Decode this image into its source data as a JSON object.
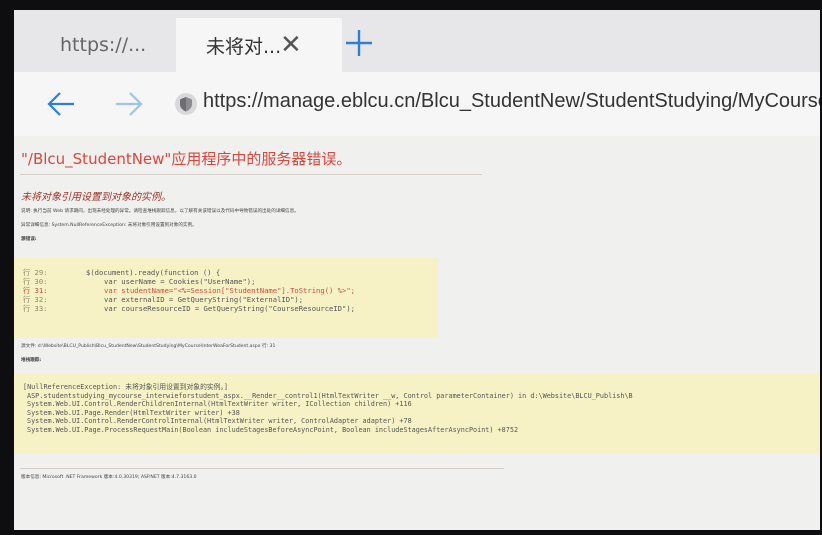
{
  "tabs": [
    {
      "title": "https://..."
    },
    {
      "title": "未将对..."
    }
  ],
  "address_bar": {
    "url": "https://manage.eblcu.cn/Blcu_StudentNew/StudentStudying/MyCourse/InterW"
  },
  "error_page": {
    "title": "\"/Blcu_StudentNew\"应用程序中的服务器错误。",
    "heading": "未将对象引用设置到对象的实例。",
    "description": "说明: 执行当前 Web 请求期间，出现未经处理的异常。请检查堆栈跟踪信息，以了解有关该错误以及代码中导致错误的出处的详细信息。",
    "exception_details": "异常详细信息: System.NullReferenceException: 未将对象引用设置到对象的实例。",
    "source_error_label": "源错误:",
    "source_lines": [
      {
        "num": "行 29:",
        "code": "$(document).ready(function () {",
        "indent": 0,
        "error": false
      },
      {
        "num": "行 30:",
        "code": "var userName = Cookies(\"UserName\");",
        "indent": 1,
        "error": false
      },
      {
        "num": "行 31:",
        "code": "var studentName=\"<%=Session[\"StudentName\"].ToString() %>\";",
        "indent": 1,
        "error": true
      },
      {
        "num": "行 32:",
        "code": "var externalID = GetQueryString(\"ExternalID\");",
        "indent": 1,
        "error": false
      },
      {
        "num": "行 33:",
        "code": "var courseResourceID = GetQueryString(\"CourseResourceID\");",
        "indent": 1,
        "error": false
      }
    ],
    "source_file": "源文件: d:\\Website\\BLCU_Publish\\Blcu_StudentNew\\StudentStudying\\MyCourse\\InterWeaForStudent.aspx    行: 31",
    "stack_trace_label": "堆栈跟踪:",
    "stack_trace": [
      "[NullReferenceException: 未将对象引用设置到对象的实例。]",
      "ASP.studentstudying_mycourse_interwieforstudent_aspx.__Render__control1(HtmlTextWriter __w, Control parameterContainer) in d:\\Website\\BLCU_Publish\\B",
      "System.Web.UI.Control.RenderChildrenInternal(HtmlTextWriter writer, ICollection children) +116",
      "System.Web.UI.Page.Render(HtmlTextWriter writer) +38",
      "System.Web.UI.Control.RenderControlInternal(HtmlTextWriter writer, ControlAdapter adapter) +78",
      "System.Web.UI.Page.ProcessRequestMain(Boolean includeStagesBeforeAsyncPoint, Boolean includeStagesAfterAsyncPoint) +8752"
    ],
    "version_info": "版本信息: Microsoft .NET Framework 版本:4.0.30319; ASP.NET 版本:4.7.3163.0"
  },
  "colors": {
    "error_title": "#d6483f",
    "code_background": "#f6f2c5",
    "accent_blue": "#2b7fd9"
  }
}
